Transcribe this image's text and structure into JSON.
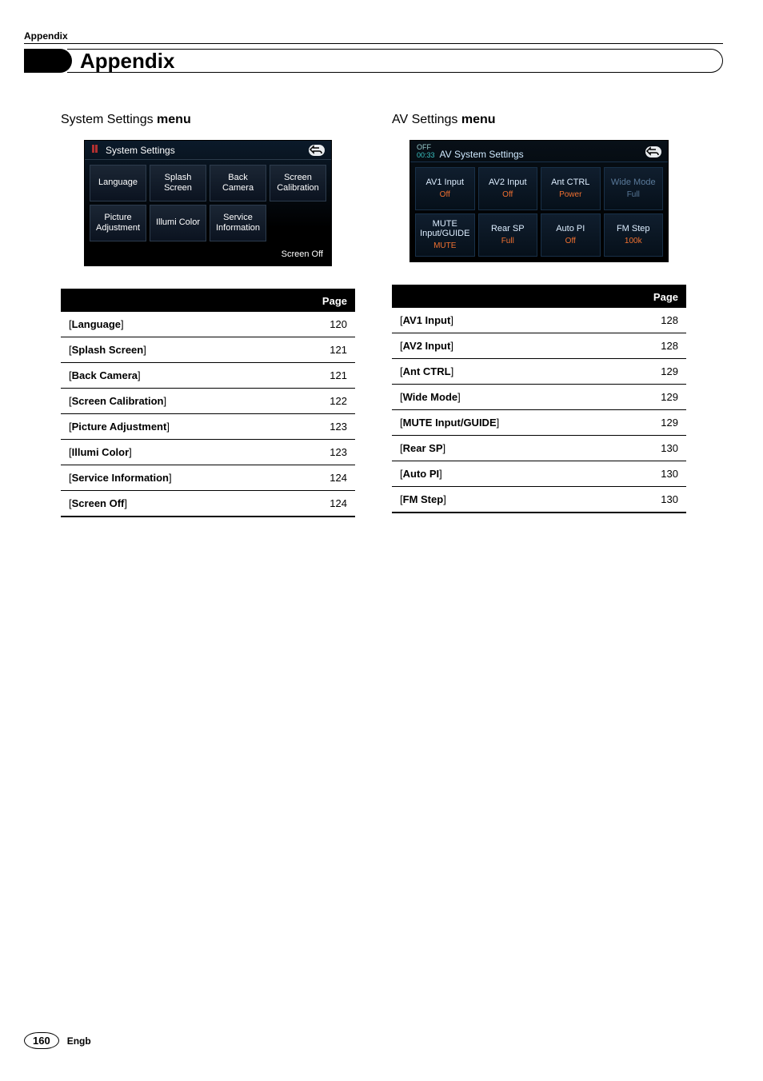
{
  "header": {
    "top_label": "Appendix",
    "title": "Appendix"
  },
  "left": {
    "heading_light": "System Settings ",
    "heading_heavy": "menu",
    "screen": {
      "title": "System Settings",
      "tiles": [
        "Language",
        "Splash\nScreen",
        "Back\nCamera",
        "Screen\nCalibration",
        "Picture\nAdjustment",
        "Illumi Color",
        "Service\nInformation"
      ],
      "footer": "Screen Off"
    },
    "table": {
      "head": [
        "",
        "Page"
      ],
      "rows": [
        {
          "label": "Language",
          "page": "120"
        },
        {
          "label": "Splash Screen",
          "page": "121"
        },
        {
          "label": "Back Camera",
          "page": "121"
        },
        {
          "label": "Screen Calibration",
          "page": "122"
        },
        {
          "label": "Picture Adjustment",
          "page": "123"
        },
        {
          "label": "Illumi Color",
          "page": "123"
        },
        {
          "label": "Service Information",
          "page": "124"
        },
        {
          "label": "Screen Off",
          "page": "124"
        }
      ]
    }
  },
  "right": {
    "heading_light": "AV Settings ",
    "heading_heavy": "menu",
    "screen": {
      "off": "OFF",
      "time": "00:33",
      "title": "AV System Settings",
      "tiles": [
        {
          "label": "AV1 Input",
          "value": "Off",
          "dim": false
        },
        {
          "label": "AV2 Input",
          "value": "Off",
          "dim": false
        },
        {
          "label": "Ant CTRL",
          "value": "Power",
          "dim": false
        },
        {
          "label": "Wide Mode",
          "value": "Full",
          "dim": true
        },
        {
          "label": "MUTE Input/GUIDE",
          "value": "MUTE",
          "dim": false
        },
        {
          "label": "Rear SP",
          "value": "Full",
          "dim": false
        },
        {
          "label": "Auto PI",
          "value": "Off",
          "dim": false
        },
        {
          "label": "FM Step",
          "value": "100k",
          "dim": false
        }
      ]
    },
    "table": {
      "head": [
        "",
        "Page"
      ],
      "rows": [
        {
          "label": "AV1 Input",
          "page": "128"
        },
        {
          "label": "AV2 Input",
          "page": "128"
        },
        {
          "label": "Ant CTRL",
          "page": "129"
        },
        {
          "label": "Wide Mode",
          "page": "129"
        },
        {
          "label": "MUTE Input/GUIDE",
          "page": "129"
        },
        {
          "label": "Rear SP",
          "page": "130"
        },
        {
          "label": "Auto PI",
          "page": "130"
        },
        {
          "label": "FM Step",
          "page": "130"
        }
      ]
    }
  },
  "footer": {
    "page": "160",
    "lang": "Engb"
  }
}
